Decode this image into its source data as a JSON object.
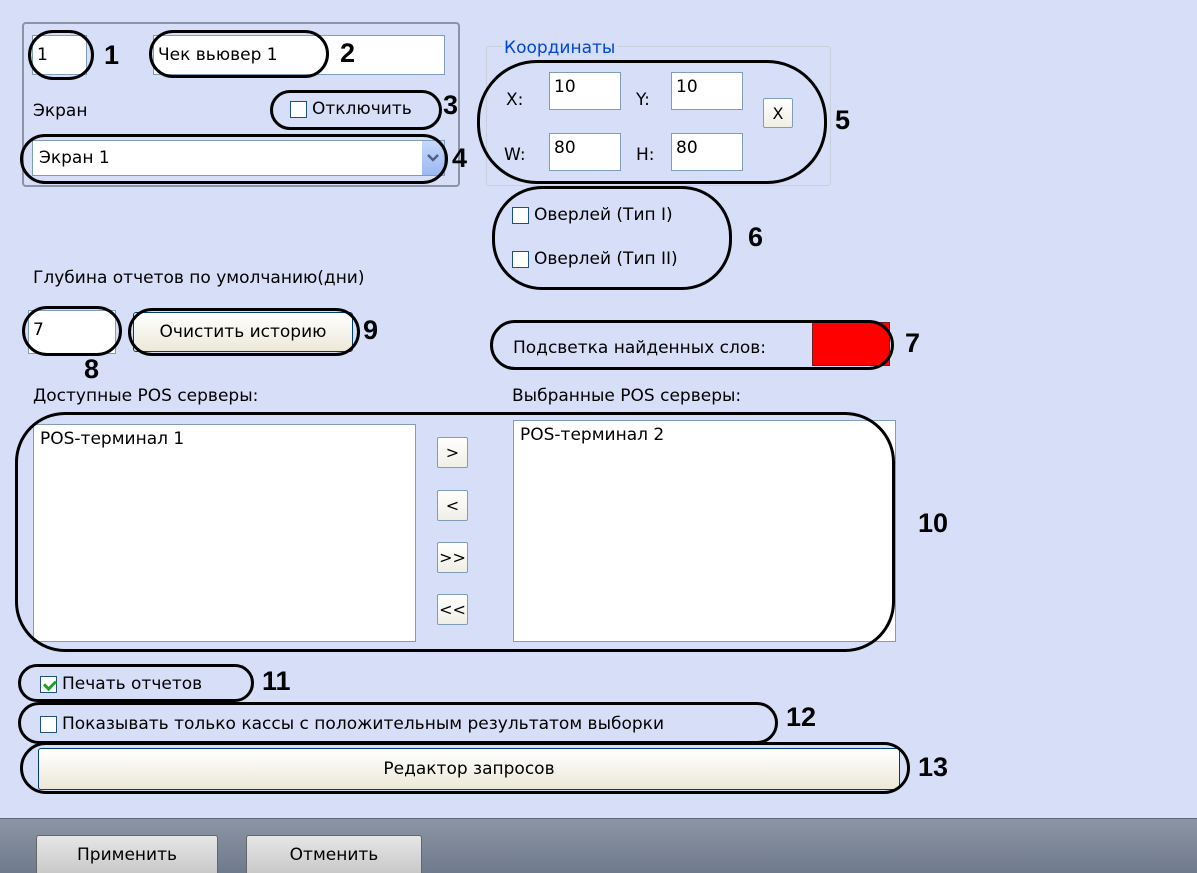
{
  "top": {
    "id_value": "1",
    "name_value": "Чек вьювер 1",
    "screen_label": "Экран",
    "disable_label": "Отключить",
    "disable_checked": false,
    "screen_select_value": "Экран 1"
  },
  "coords": {
    "title": "Координаты",
    "x_label": "X:",
    "x_value": "10",
    "y_label": "Y:",
    "y_value": "10",
    "w_label": "W:",
    "w_value": "80",
    "h_label": "H:",
    "h_value": "80",
    "reset_label": "X"
  },
  "overlay": {
    "type1_label": "Оверлей (Тип I)",
    "type2_label": "Оверлей (Тип II)"
  },
  "depth": {
    "label": "Глубина отчетов по умолчанию(дни)",
    "value": "7",
    "clear_label": "Очистить историю"
  },
  "highlight": {
    "label": "Подсветка найденных слов:",
    "color": "#ff0000"
  },
  "servers": {
    "available_label": "Доступные POS серверы:",
    "selected_label": "Выбранные POS серверы:",
    "available": [
      "POS-терминал 1"
    ],
    "selected": [
      "POS-терминал 2"
    ],
    "move_right": ">",
    "move_left": "<",
    "move_all_right": ">>",
    "move_all_left": "<<"
  },
  "options": {
    "print_label": "Печать отчетов",
    "print_checked": true,
    "positive_only_label": "Показывать только кассы с положительным результатом выборки",
    "positive_only_checked": false,
    "query_editor_label": "Редактор запросов"
  },
  "annotations": [
    "1",
    "2",
    "3",
    "4",
    "5",
    "6",
    "7",
    "8",
    "9",
    "10",
    "11",
    "12",
    "13"
  ],
  "footer": {
    "apply_label": "Применить",
    "cancel_label": "Отменить"
  }
}
